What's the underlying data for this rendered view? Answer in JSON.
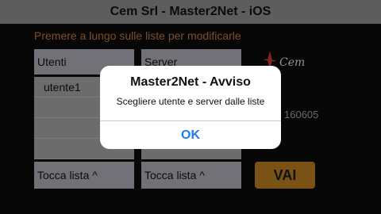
{
  "title": "Cem Srl - Master2Net - iOS",
  "hint": "Premere a lungo sulle liste per modificarle",
  "users": {
    "header": "Utenti",
    "items": [
      "utente1",
      "",
      "",
      ""
    ],
    "footer": "Tocca lista ^"
  },
  "servers": {
    "header": "Server",
    "footer": "Tocca lista ^"
  },
  "go_label": "VAI",
  "version": "160605",
  "logo_text": "Cem",
  "alert": {
    "title": "Master2Net - Avviso",
    "message": "Scegliere utente e server dalle liste",
    "ok": "OK"
  },
  "colors": {
    "accent": "#b47a1f",
    "hint": "#b6733c",
    "alert_button": "#1e7cf0"
  }
}
